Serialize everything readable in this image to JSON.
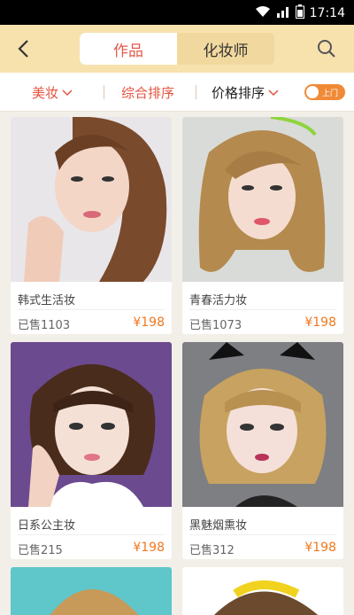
{
  "status_bar": {
    "time": "17:14"
  },
  "header": {
    "tabs": [
      {
        "label": "作品",
        "active": true
      },
      {
        "label": "化妆师",
        "active": false
      }
    ]
  },
  "filters": {
    "category": "美妆",
    "sort_overall": "综合排序",
    "sort_price": "价格排序",
    "toggle_label": "上门",
    "accent_color": "#e5533f",
    "price_color": "#f0781f"
  },
  "products": [
    {
      "name": "韩式生活妆",
      "sold": "已售1103",
      "price": "¥198"
    },
    {
      "name": "青春活力妆",
      "sold": "已售1073",
      "price": "¥198"
    },
    {
      "name": "日系公主妆",
      "sold": "已售215",
      "price": "¥198"
    },
    {
      "name": "黑魅烟熏妆",
      "sold": "已售312",
      "price": "¥198"
    }
  ]
}
